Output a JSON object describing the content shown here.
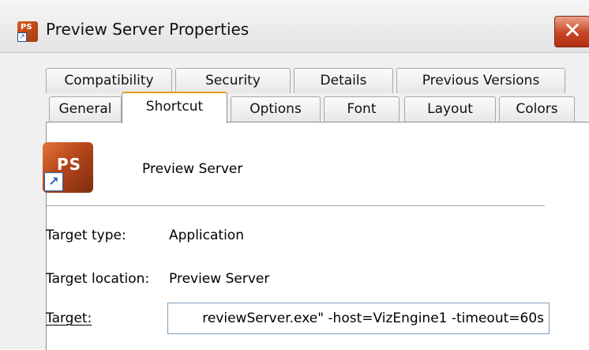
{
  "window": {
    "title": "Preview Server Properties",
    "close_glyph": "✕"
  },
  "tabs_row1": [
    {
      "label": "Compatibility"
    },
    {
      "label": "Security"
    },
    {
      "label": "Details"
    },
    {
      "label": "Previous Versions"
    }
  ],
  "tabs_row2": [
    {
      "label": "General"
    },
    {
      "label": "Shortcut",
      "active": true
    },
    {
      "label": "Options"
    },
    {
      "label": "Font"
    },
    {
      "label": "Layout"
    },
    {
      "label": "Colors"
    }
  ],
  "shortcut": {
    "icon_text": "PS",
    "name": "Preview Server",
    "target_type_label": "Target type:",
    "target_type_value": "Application",
    "target_location_label": "Target location:",
    "target_location_value": "Preview Server",
    "target_label": "Target:",
    "target_value": "reviewServer.exe\" -host=VizEngine1 -timeout=60s"
  }
}
